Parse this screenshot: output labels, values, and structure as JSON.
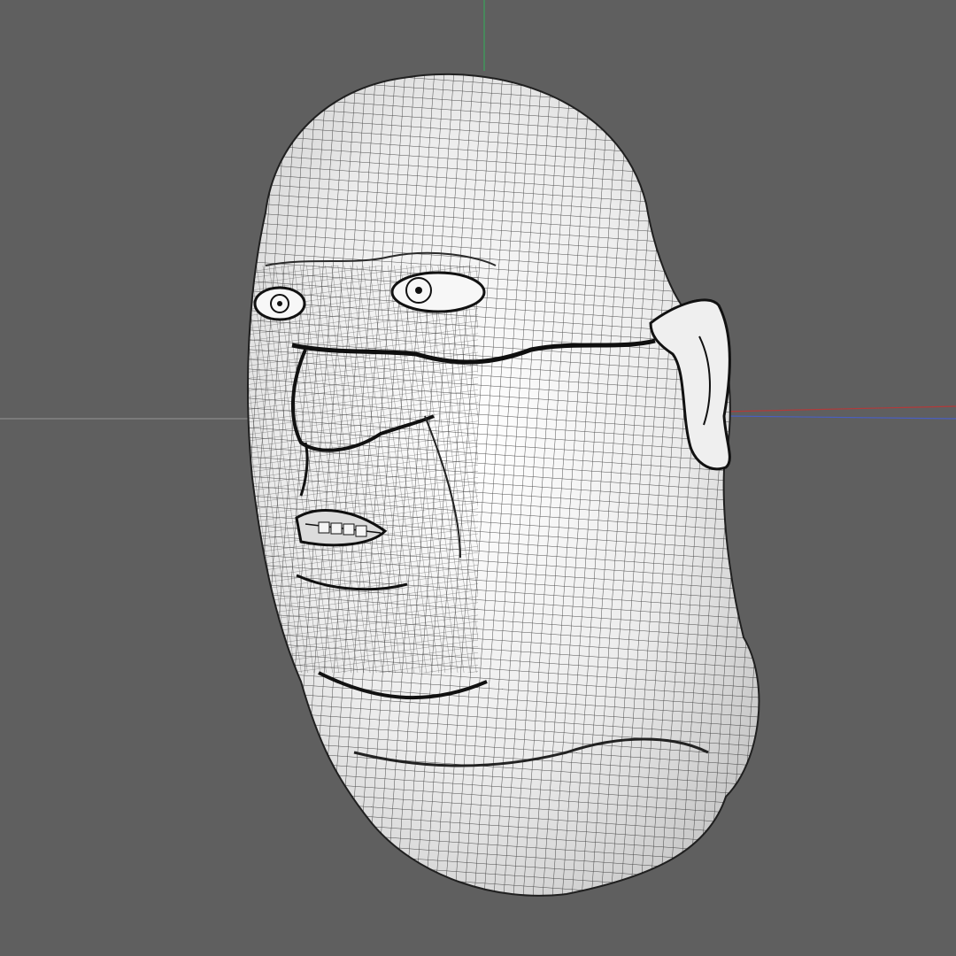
{
  "viewport": {
    "background_color": "#5f5f5f",
    "shading_mode": "wireframe-on-shaded",
    "axis_colors": {
      "x": "#b23a3a",
      "y": "#3aa55a",
      "z": "#4a5fc0",
      "horizon": "#8a8a8a"
    }
  },
  "model": {
    "name": "",
    "surface_color": "#f2f2f2",
    "wire_color": "#1a1a1a"
  }
}
